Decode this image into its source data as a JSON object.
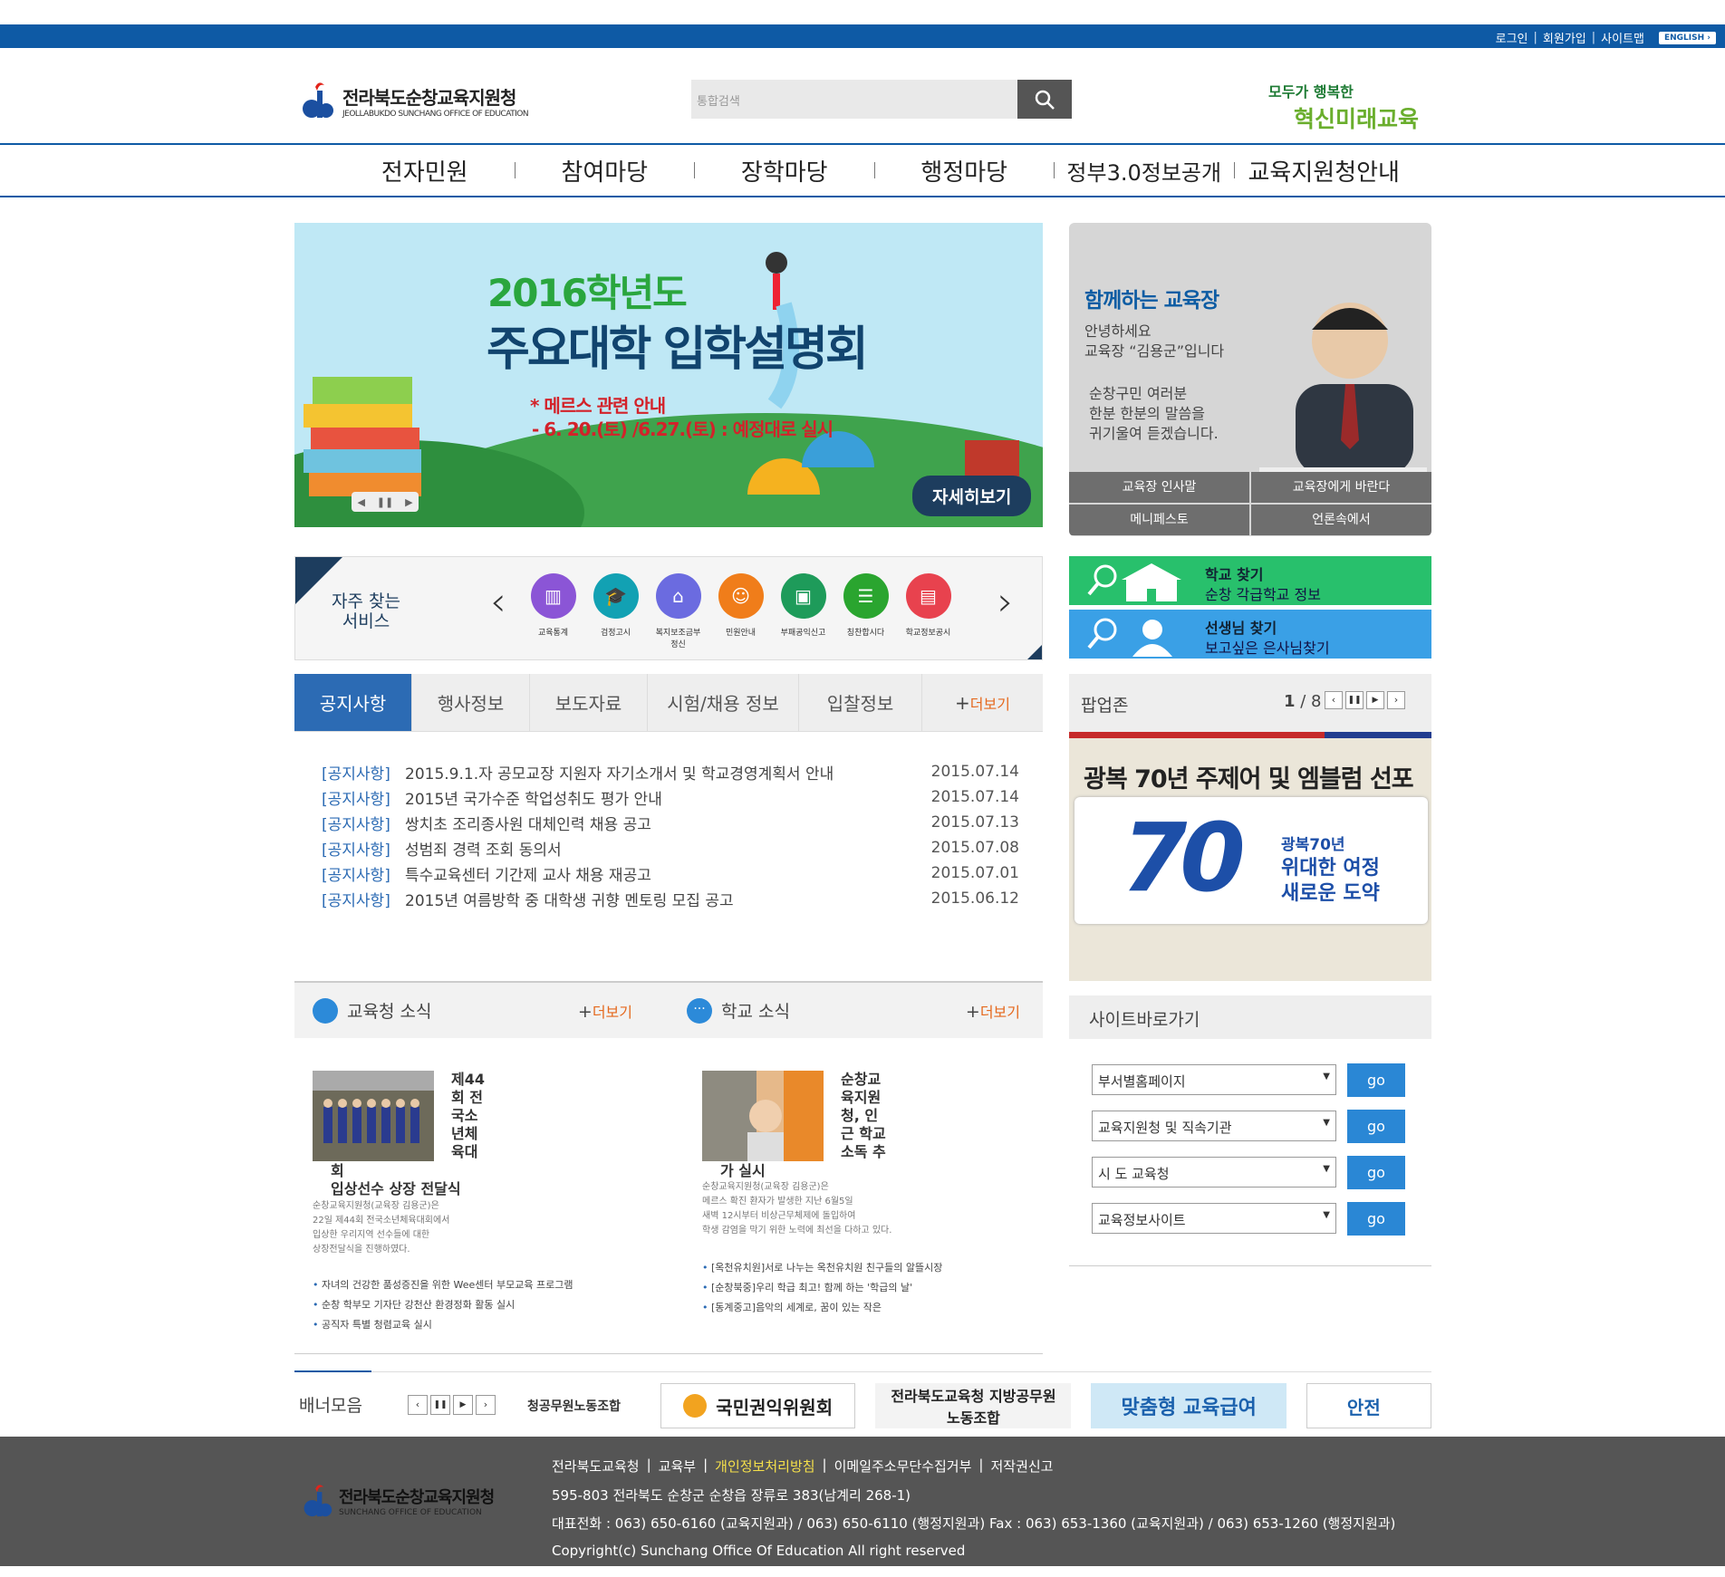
{
  "util": {
    "login": "로그인",
    "join": "회원가입",
    "sitemap": "사이트맵",
    "english": "ENGLISH"
  },
  "logo": {
    "name": "전라북도순창교육지원청",
    "sub": "JEOLLABUKDO SUNCHANG OFFICE OF EDUCATION"
  },
  "search": {
    "placeholder": "통합검색"
  },
  "slogan": {
    "line1": "모두가 행복한",
    "line2": "혁신미래교육"
  },
  "gnb": [
    "전자민원",
    "참여마당",
    "장학마당",
    "행정마당",
    "정부3.0정보공개",
    "교육지원청안내"
  ],
  "banner": {
    "title1": "2016학년도",
    "title2": "주요대학 입학설명회",
    "note1": "* 메르스 관련 안내",
    "note2": "- 6. 20.(토) /6.27.(토) : 예정대로 실시",
    "detail": "자세히보기"
  },
  "superintendent": {
    "title": "함께하는 교육장",
    "greet1": "안녕하세요",
    "greet2": "교육장 “김용군”입니다",
    "msg1": "순창구민 여러분",
    "msg2": "한분 한분의 말씀을",
    "msg3": "귀기울여 듣겠습니다.",
    "btns": [
      "교육장 인사말",
      "교육장에게 바란다",
      "메니페스토",
      "언론속에서"
    ]
  },
  "faq": {
    "label1": "자주 찾는",
    "label2": "서비스",
    "items": [
      {
        "label": "교육통계",
        "color": "#8b55d6",
        "icon": "chart-icon"
      },
      {
        "label": "검정고시",
        "color": "#12a1b3",
        "icon": "graduation-cap-icon"
      },
      {
        "label": "복지보조금부정신",
        "color": "#6b6be0",
        "icon": "house-icon"
      },
      {
        "label": "민원안내",
        "color": "#f07d1a",
        "icon": "person-icon"
      },
      {
        "label": "부패공익신고",
        "color": "#1e9b5a",
        "icon": "window-icon"
      },
      {
        "label": "칭찬합시다",
        "color": "#2aa52f",
        "icon": "chat-icon"
      },
      {
        "label": "학교정보공시",
        "color": "#e8424e",
        "icon": "clipboard-icon"
      }
    ]
  },
  "schoolfind": {
    "title": "학교 찾기",
    "sub": "순창 각급학교 정보"
  },
  "teacherfind": {
    "title": "선생님 찾기",
    "sub": "보고싶은 은사님찾기"
  },
  "tabs": [
    "공지사항",
    "행사정보",
    "보도자료",
    "시험/채용 정보",
    "입찰정보"
  ],
  "more": "더보기",
  "notices": [
    {
      "cat": "[공지사항]",
      "title": "2015.9.1.자 공모교장 지원자 자기소개서 및 학교경영계획서 안내",
      "date": "2015.07.14"
    },
    {
      "cat": "[공지사항]",
      "title": "2015년 국가수준 학업성취도 평가 안내",
      "date": "2015.07.14"
    },
    {
      "cat": "[공지사항]",
      "title": "쌍치초 조리종사원 대체인력 채용 공고",
      "date": "2015.07.13"
    },
    {
      "cat": "[공지사항]",
      "title": "성범죄 경력 조회 동의서",
      "date": "2015.07.08"
    },
    {
      "cat": "[공지사항]",
      "title": "특수교육센터 기간제 교사 채용 재공고",
      "date": "2015.07.01"
    },
    {
      "cat": "[공지사항]",
      "title": "2015년 여름방학 중 대학생 귀향 멘토링 모집 공고",
      "date": "2015.06.12"
    }
  ],
  "popup": {
    "title": "팝업존",
    "page": "1",
    "total": "8",
    "img_title": "광복 70년 주제어 및 엠블럼 선포",
    "num": "70",
    "sub1": "광복70년",
    "sub2": "위대한 여정",
    "sub3": "새로운 도약"
  },
  "office_news": {
    "title": "교육청 소식",
    "head1": "제44",
    "head2": "회 전",
    "head3": "국소",
    "head4": "년체",
    "head5": "육대",
    "head6": "회",
    "head7": "입상선수 상장 전달식",
    "body1": "순창교육지원청(교육장 김용군)은",
    "body2": "22일 제44회 전국소년체육대회에서",
    "body3": "입상한 우리지역 선수들에 대한",
    "body4": "상장전달식을 진행하였다.",
    "list": [
      "자녀의 건강한 품성증진을 위한 Wee센터 부모교육 프로그램",
      "순창 학부모 기자단 강천산 환경정화 활동 실시",
      "공직자 특별 청렴교육 실시"
    ]
  },
  "school_news": {
    "title": "학교 소식",
    "head1": "순창교",
    "head2": "육지원",
    "head3": "청, 인",
    "head4": "근 학교",
    "head5": "소독 추",
    "head6": "가 실시",
    "body1": "순창교육지원청(교육장 김용군)은",
    "body2": "메르스 확진 환자가 발생한 지난 6월5일",
    "body3": "새벽 12시부터 비상근무체제에 돌입하여",
    "body4": "학생 감염을 막기 위한 노력에 최선을 다하고 있다.",
    "list": [
      "[옥천유치원]서로 나누는 옥천유치원 친구들의 알뜰시장",
      "[순창북중]우리 학급 최고! 함께 하는 '학급의 날'",
      "[동계중고]음악의 세계로, 꿈이 있는 작은"
    ]
  },
  "sitego": {
    "title": "사이트바로가기",
    "selects": [
      "부서별홈페이지",
      "교육지원청 및 직속기관",
      "시 도 교육청",
      "교육정보사이트"
    ],
    "go": "go"
  },
  "banners": {
    "label": "배너모음",
    "items": [
      "청공무원노동조합",
      "국민권익위원회",
      "전라북도교육청 지방공무원노동조합",
      "맞춤형 교육급여",
      "안전"
    ]
  },
  "footer": {
    "links": [
      "전라북도교육청",
      "교육부",
      "개인정보처리방침",
      "이메일주소무단수집거부",
      "저작권신고"
    ],
    "addr": "595-803 전라북도 순창군 순창읍 장류로 383(남계리 268-1)",
    "tel": "대표전화 : 063) 650-6160 (교육지원과) / 063) 650-6110 (행정지원과)  Fax : 063) 653-1360 (교육지원과) / 063) 653-1260 (행정지원과)",
    "copy": "Copyright(c) Sunchang Office Of Education All right reserved",
    "logo": "전라북도순창교육지원청",
    "logo_sub": "SUNCHANG OFFICE OF EDUCATION"
  },
  "colors": {
    "primary": "#0e5aa5",
    "accent": "#e5691e",
    "footer": "#555555"
  }
}
